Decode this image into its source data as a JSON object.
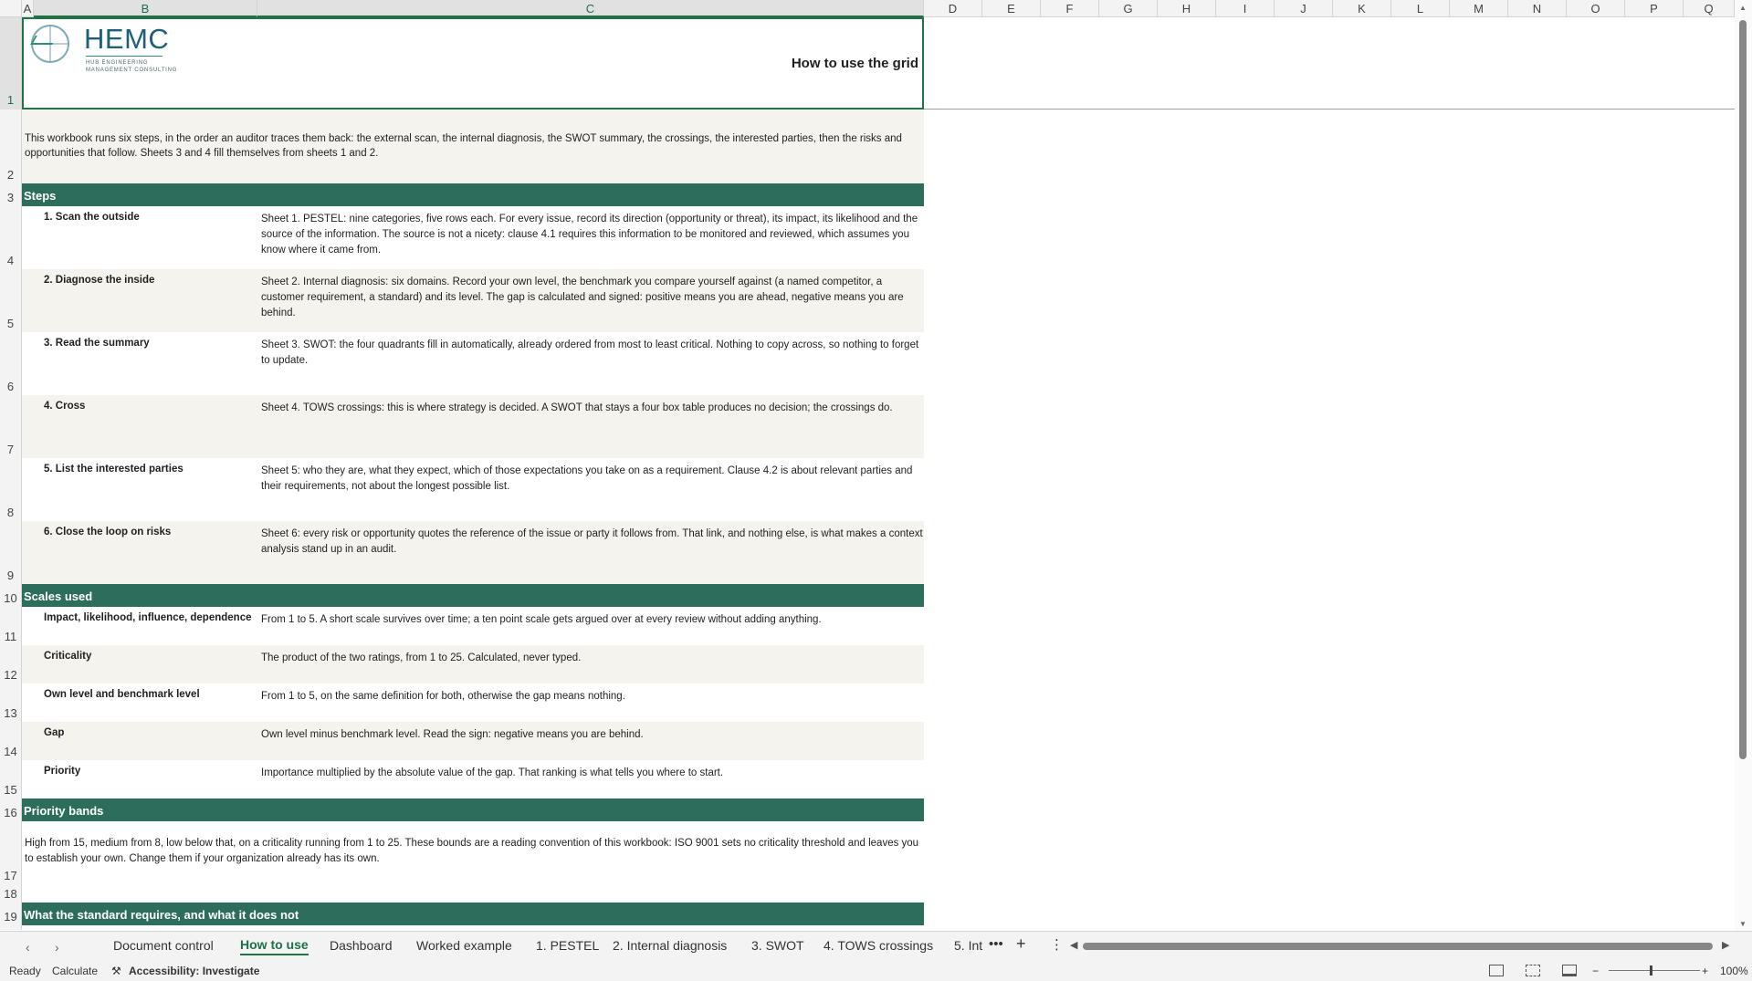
{
  "column_headers": [
    "A",
    "B",
    "C",
    "D",
    "E",
    "F",
    "G",
    "H",
    "I",
    "J",
    "K",
    "L",
    "M",
    "N",
    "O",
    "P",
    "Q"
  ],
  "row_numbers": [
    "1",
    "2",
    "3",
    "4",
    "5",
    "6",
    "7",
    "8",
    "9",
    "10",
    "11",
    "12",
    "13",
    "14",
    "15",
    "16",
    "17",
    "18",
    "19"
  ],
  "header": {
    "logo_text": "HEMC",
    "logo_subtitle": "HUB ENGINEERING MANAGEMENT CONSULTING",
    "title": "How to use the grid"
  },
  "intro": "This workbook runs six steps, in the order an auditor traces them back: the external scan, the internal diagnosis, the SWOT summary, the crossings, the interested parties, then the risks and opportunities that follow. Sheets 3 and 4 fill themselves from sheets 1 and 2.",
  "sections": {
    "steps": "Steps",
    "scales": "Scales used",
    "priority": "Priority bands",
    "standard": "What the standard requires, and what it does not"
  },
  "steps": [
    {
      "label": "1. Scan the outside",
      "text": "Sheet 1. PESTEL: nine categories, five rows each. For every issue, record its direction (opportunity or threat), its impact, its likelihood and the source of the information. The source is not a nicety: clause 4.1 requires this information to be monitored and reviewed, which assumes you know where it came from."
    },
    {
      "label": "2. Diagnose the inside",
      "text": "Sheet 2. Internal diagnosis: six domains. Record your own level, the benchmark you compare yourself against (a named competitor, a customer requirement, a standard) and its level. The gap is calculated and signed: positive means you are ahead, negative means you are behind."
    },
    {
      "label": "3. Read the summary",
      "text": "Sheet 3. SWOT: the four quadrants fill in automatically, already ordered from most to least critical. Nothing to copy across, so nothing to forget to update."
    },
    {
      "label": "4. Cross",
      "text": "Sheet 4. TOWS crossings: this is where strategy is decided. A SWOT that stays a four box table produces no decision; the crossings do."
    },
    {
      "label": "5. List the interested parties",
      "text": "Sheet 5: who they are, what they expect, which of those expectations you take on as a requirement. Clause 4.2 is about relevant parties and their requirements, not about the longest possible list."
    },
    {
      "label": "6. Close the loop on risks",
      "text": "Sheet 6: every risk or opportunity quotes the reference of the issue or party it follows from. That link, and nothing else, is what makes a context analysis stand up in an audit."
    }
  ],
  "scales": [
    {
      "label": "Impact, likelihood, influence, dependence",
      "text": "From 1 to 5. A short scale survives over time; a ten point scale gets argued over at every review without adding anything."
    },
    {
      "label": "Criticality",
      "text": "The product of the two ratings, from 1 to 25. Calculated, never typed."
    },
    {
      "label": "Own level and benchmark level",
      "text": "From 1 to 5, on the same definition for both, otherwise the gap means nothing."
    },
    {
      "label": "Gap",
      "text": "Own level minus benchmark level. Read the sign: negative means you are behind."
    },
    {
      "label": "Priority",
      "text": "Importance multiplied by the absolute value of the gap. That ranking is what tells you where to start."
    }
  ],
  "priority_text": "High from 15, medium from 8, low below that, on a criticality running from 1 to 25. These bounds are a reading convention of this workbook: ISO 9001 sets no criticality threshold and leaves you to establish your own. Change them if your organization already has its own.",
  "tabs": [
    "Document control",
    "How to use",
    "Dashboard",
    "Worked example",
    "1. PESTEL",
    "2. Internal diagnosis",
    "3. SWOT",
    "4. TOWS crossings",
    "5. Int"
  ],
  "active_tab": "How to use",
  "status": {
    "ready": "Ready",
    "calculate": "Calculate",
    "accessibility": "Accessibility: Investigate",
    "zoom": "100%"
  },
  "colors": {
    "accent": "#217346",
    "section_fill": "#2c6e5b",
    "band_fill": "#f4f3ee"
  }
}
